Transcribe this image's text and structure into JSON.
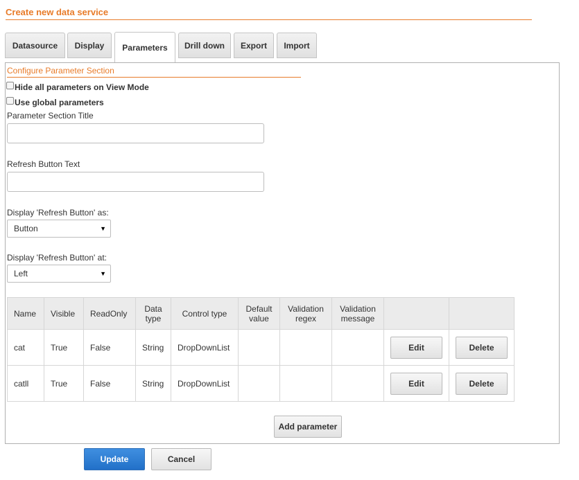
{
  "page_title": "Create new data service",
  "tabs": [
    {
      "label": "Datasource"
    },
    {
      "label": "Display"
    },
    {
      "label": "Parameters",
      "active": true
    },
    {
      "label": "Drill down"
    },
    {
      "label": "Export"
    },
    {
      "label": "Import"
    }
  ],
  "section": {
    "title": "Configure Parameter Section",
    "hide_params_label": "Hide all parameters on View Mode",
    "global_params_label": "Use global parameters",
    "section_title_label": "Parameter Section Title",
    "section_title_value": "",
    "refresh_text_label": "Refresh Button Text",
    "refresh_text_value": "",
    "refresh_as_label": "Display 'Refresh Button' as:",
    "refresh_as_value": "Button",
    "refresh_at_label": "Display 'Refresh Button' at:",
    "refresh_at_value": "Left"
  },
  "table": {
    "headers": {
      "name": "Name",
      "visible": "Visible",
      "readonly": "ReadOnly",
      "datatype": "Data type",
      "controltype": "Control type",
      "default": "Default value",
      "regex": "Validation regex",
      "message": "Validation message"
    },
    "rows": [
      {
        "name": "cat",
        "visible": "True",
        "readonly": "False",
        "datatype": "String",
        "controltype": "DropDownList",
        "default": "",
        "regex": "",
        "message": "",
        "edit": "Edit",
        "delete": "Delete"
      },
      {
        "name": "catll",
        "visible": "True",
        "readonly": "False",
        "datatype": "String",
        "controltype": "DropDownList",
        "default": "",
        "regex": "",
        "message": "",
        "edit": "Edit",
        "delete": "Delete"
      }
    ]
  },
  "add_parameter_label": "Add parameter",
  "update_label": "Update",
  "cancel_label": "Cancel",
  "colors": {
    "accent": "#e87b29",
    "primary": "#2270c8"
  }
}
